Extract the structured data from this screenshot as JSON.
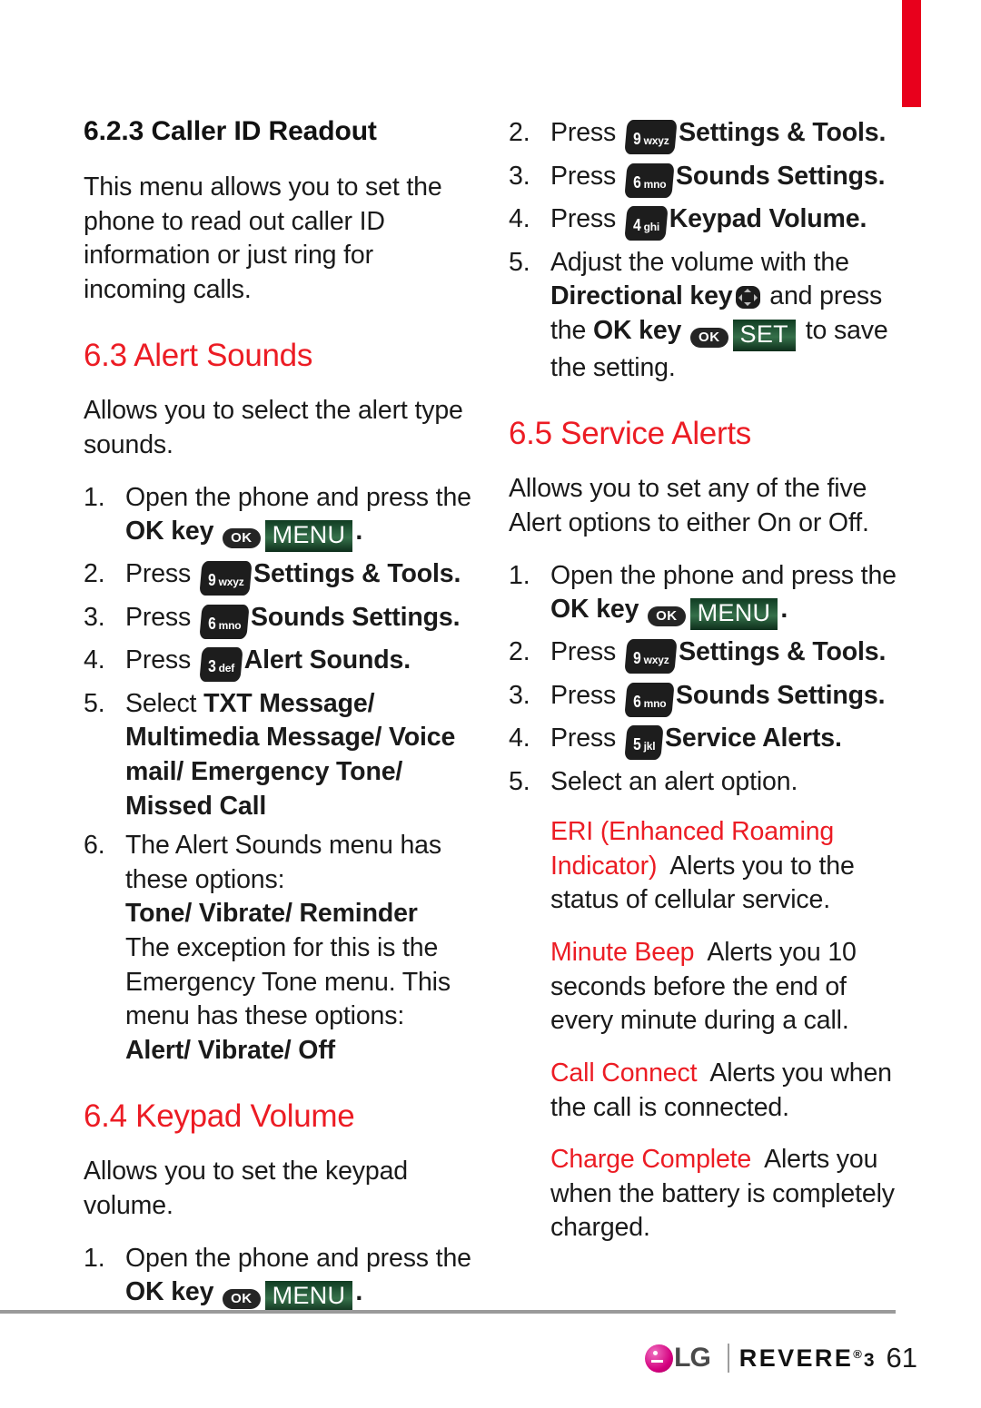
{
  "page": {
    "number": "61",
    "accent_red": "#EC1C24",
    "softkey_green": "#2c6a42"
  },
  "footer": {
    "brand": "LG",
    "model": "REVERE",
    "model_tm": "®",
    "model_version": "3",
    "page_number": "61"
  },
  "keys": {
    "ok": "OK",
    "menu": "MENU",
    "set": "SET",
    "nine": {
      "digit": "9",
      "letters": "wxyz"
    },
    "six": {
      "digit": "6",
      "letters": "mno"
    },
    "five": {
      "digit": "5",
      "letters": "jkl"
    },
    "four": {
      "digit": "4",
      "letters": "ghi"
    },
    "three": {
      "digit": "3",
      "letters": "def"
    }
  },
  "left_column": {
    "subheading": "6.2.3 Caller ID Readout",
    "intro": "This menu allows you to set the phone to read out caller ID information or just ring for incoming calls.",
    "section_63": {
      "heading": "6.3 Alert Sounds",
      "intro": "Allows you to select the alert type sounds.",
      "steps": [
        {
          "num": "1.",
          "pre": "Open the phone and press the ",
          "bold1": "OK key",
          "post": "."
        },
        {
          "num": "2.",
          "pre": "Press ",
          "bold1": "Settings & Tools",
          "post": "."
        },
        {
          "num": "3.",
          "pre": "Press ",
          "bold1": "Sounds Settings",
          "post": "."
        },
        {
          "num": "4.",
          "pre": "Press ",
          "bold1": "Alert Sounds",
          "post": "."
        },
        {
          "num": "5.",
          "pre": "Select ",
          "bold1": "TXT Message/ Multimedia Message/ Voice mail/ Emergency Tone/ Missed Call",
          "post": ""
        },
        {
          "num": "6.",
          "pre": "The Alert Sounds menu has these options:",
          "bold1": "Tone/ Vibrate/ Reminder",
          "mid": "The exception for this is the Emergency Tone menu. This menu has these options:",
          "bold2": "Alert/ Vibrate/ Off"
        }
      ]
    },
    "section_64": {
      "heading": "6.4 Keypad Volume",
      "intro": "Allows you to set the keypad volume.",
      "steps": [
        {
          "num": "1.",
          "pre": "Open the phone and press the ",
          "bold1": "OK key",
          "post": "."
        }
      ]
    }
  },
  "right_column": {
    "section_64_cont": {
      "steps": [
        {
          "num": "2.",
          "pre": "Press ",
          "bold1": "Settings & Tools",
          "post": "."
        },
        {
          "num": "3.",
          "pre": "Press ",
          "bold1": "Sounds Settings",
          "post": "."
        },
        {
          "num": "4.",
          "pre": "Press ",
          "bold1": "Keypad Volume",
          "post": "."
        },
        {
          "num": "5.",
          "pre": "Adjust the volume with the ",
          "bold1": "Directional key",
          "mid": " and press the ",
          "bold2": "OK key",
          "post": " to save the setting."
        }
      ]
    },
    "section_65": {
      "heading": "6.5 Service Alerts",
      "intro": "Allows you to set any of the five Alert options to either On or Off.",
      "steps": [
        {
          "num": "1.",
          "pre": "Open the phone and press the ",
          "bold1": "OK key",
          "post": "."
        },
        {
          "num": "2.",
          "pre": "Press ",
          "bold1": "Settings & Tools",
          "post": "."
        },
        {
          "num": "3.",
          "pre": "Press ",
          "bold1": "Sounds Settings",
          "post": "."
        },
        {
          "num": "4.",
          "pre": "Press ",
          "bold1": "Service Alerts",
          "post": "."
        },
        {
          "num": "5.",
          "pre": "Select an alert option.",
          "bold1": "",
          "post": ""
        }
      ],
      "definitions": [
        {
          "term": "ERI (Enhanced Roaming Indicator)",
          "desc": "Alerts you to the status of cellular service."
        },
        {
          "term": "Minute Beep",
          "desc": "Alerts you 10 seconds before the end of every minute during a call."
        },
        {
          "term": "Call Connect",
          "desc": "Alerts you when the call is connected."
        },
        {
          "term": "Charge Complete",
          "desc": "Alerts you when the battery is completely charged."
        }
      ]
    }
  }
}
